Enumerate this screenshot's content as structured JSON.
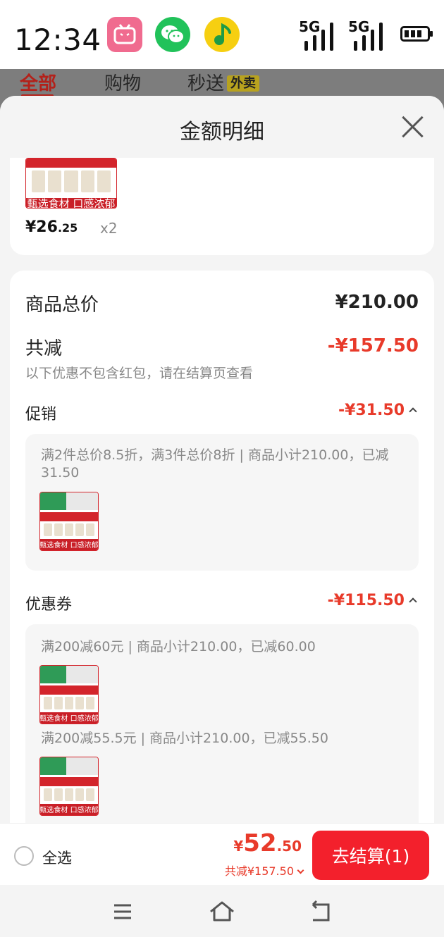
{
  "status_bar": {
    "time": "12:34",
    "network_1": "5G",
    "network_2": "5G",
    "apps": [
      "bilibili-icon",
      "wechat-icon",
      "qq-music-icon"
    ]
  },
  "background_tabs": {
    "items": [
      {
        "label": "全部"
      },
      {
        "label": "购物"
      },
      {
        "label": "秒送"
      }
    ],
    "badge": "外卖"
  },
  "sheet": {
    "title": "金额明细",
    "item": {
      "caption": "甄选食材 口感浓郁",
      "price_prefix": "¥26",
      "price_decimal": ".25",
      "quantity": "x2"
    },
    "summary": {
      "total_label": "商品总价",
      "total_value": "¥210.00",
      "reduced_label": "共减",
      "reduced_value": "-¥157.50",
      "note": "以下优惠不包含红包，请在结算页查看"
    },
    "promotion": {
      "label": "促销",
      "value": "-¥31.50",
      "detail": "满2件总价8.5折，满3件总价8折 | 商品小计210.00，已减31.50",
      "caption": "甄选食材 口感浓郁"
    },
    "coupon": {
      "label": "优惠券",
      "value": "-¥115.50",
      "details": [
        {
          "text": "满200减60元 | 商品小计210.00，已减60.00",
          "caption": "甄选食材 口感浓郁"
        },
        {
          "text": "满200减55.5元 | 商品小计210.00，已减55.50",
          "caption": "甄选食材 口感浓郁"
        }
      ]
    }
  },
  "bottom_bar": {
    "select_all": "全选",
    "price_symbol": "¥",
    "price_int": "52",
    "price_dec": ".50",
    "saved": "共减¥157.50",
    "checkout": "去结算(1)"
  },
  "colors": {
    "accent_red": "#e83a2a",
    "button_red": "#f3202c",
    "bg": "#f4f4f4"
  }
}
